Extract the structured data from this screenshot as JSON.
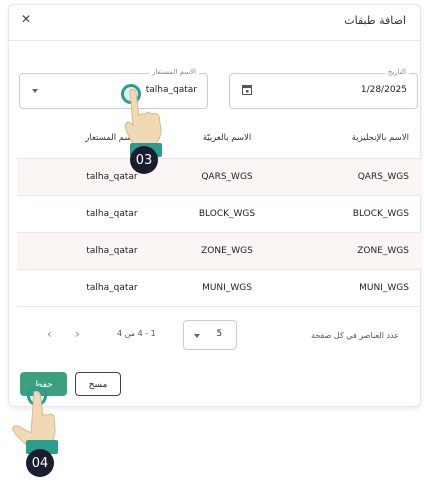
{
  "dialog": {
    "title": "اضافة طبقات",
    "close_glyph": "✕"
  },
  "form": {
    "date": {
      "label": "التاريخ",
      "value": "1/28/2025"
    },
    "user": {
      "label": "الاسم المستعار",
      "value": "talha_qatar"
    }
  },
  "table": {
    "headers": {
      "english": "الاسم بالإنجليزية",
      "arabic": "الاسم بالعربيّة",
      "user": "الاسم المستعار"
    },
    "rows": [
      {
        "english": "QARS_WGS",
        "arabic": "QARS_WGS",
        "user": "talha_qatar"
      },
      {
        "english": "BLOCK_WGS",
        "arabic": "BLOCK_WGS",
        "user": "talha_qatar"
      },
      {
        "english": "ZONE_WGS",
        "arabic": "ZONE_WGS",
        "user": "talha_qatar"
      },
      {
        "english": "MUNI_WGS",
        "arabic": "MUNI_WGS",
        "user": "talha_qatar"
      }
    ]
  },
  "pagination": {
    "per_page_label": "عدد العناصر في كل صفحة",
    "per_page_value": "5",
    "range_text": "1 - 4 من 4",
    "prev_glyph": "‹",
    "next_glyph": "›"
  },
  "actions": {
    "save_label": "حفظ",
    "clear_label": "مسح"
  },
  "steps": {
    "step3": "03",
    "step4": "04"
  },
  "colors": {
    "accent": "#3aa07d",
    "step_ring": "#2a9d8f",
    "badge": "#1a1d2e",
    "alt_row": "#fbf5f4"
  },
  "icons": {
    "calendar": "calendar-icon",
    "hand": "pointing-hand-icon"
  }
}
